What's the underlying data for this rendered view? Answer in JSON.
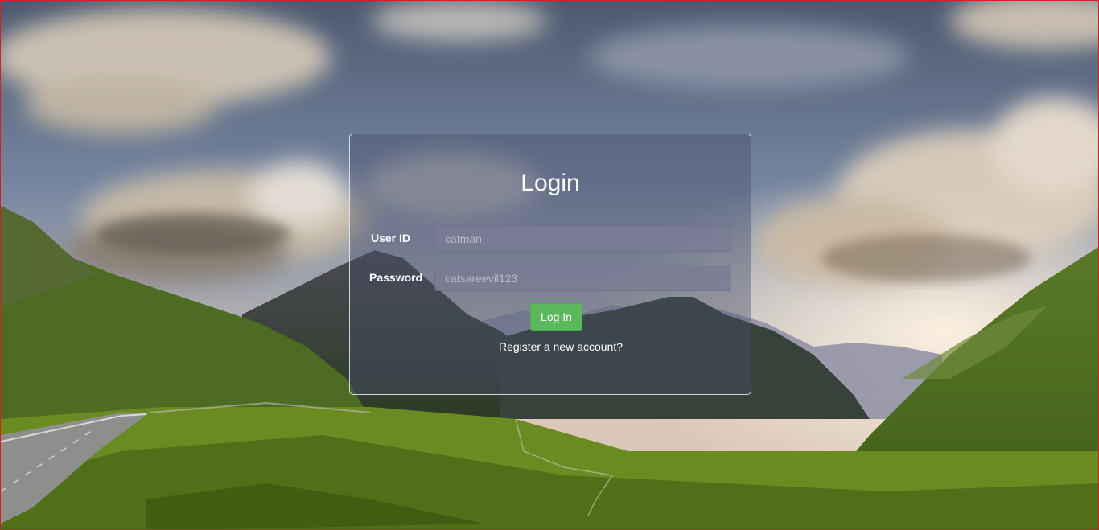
{
  "login": {
    "title": "Login",
    "user_id_label": "User ID",
    "user_id_value": "catman",
    "password_label": "Password",
    "password_value": "catsareevil123",
    "login_button_label": "Log In",
    "register_link_label": "Register a new account?"
  },
  "colors": {
    "button_green": "#5cb85c",
    "panel_border": "#ebf0f8",
    "frame_border": "#d81e1e"
  }
}
